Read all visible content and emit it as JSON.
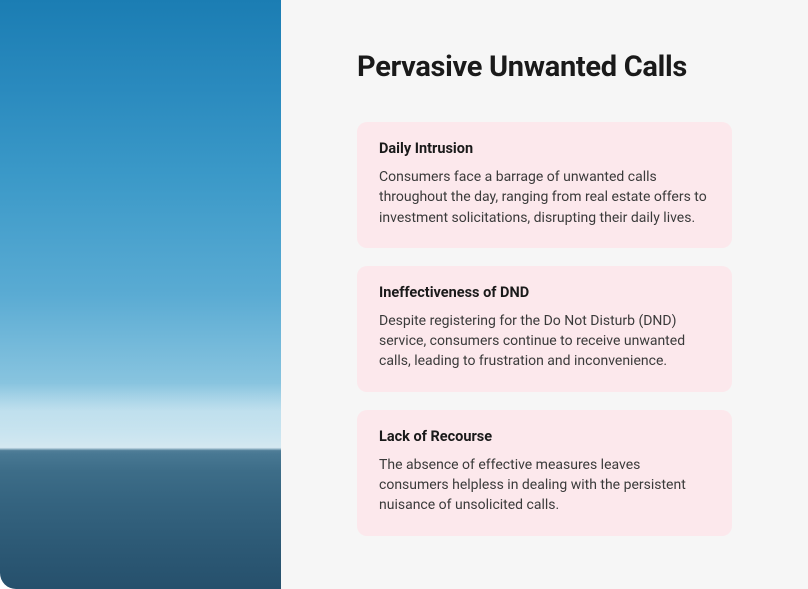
{
  "title": "Pervasive Unwanted Calls",
  "cards": [
    {
      "title": "Daily Intrusion",
      "body": "Consumers face a barrage of unwanted calls throughout the day, ranging from real estate offers to investment solicitations, disrupting their daily lives."
    },
    {
      "title": "Ineffectiveness of DND",
      "body": "Despite registering for the Do Not Disturb (DND) service, consumers continue to receive unwanted calls, leading to frustration and inconvenience."
    },
    {
      "title": "Lack of Recourse",
      "body": "The absence of effective measures leaves consumers helpless in dealing with the persistent nuisance of unsolicited calls."
    }
  ]
}
